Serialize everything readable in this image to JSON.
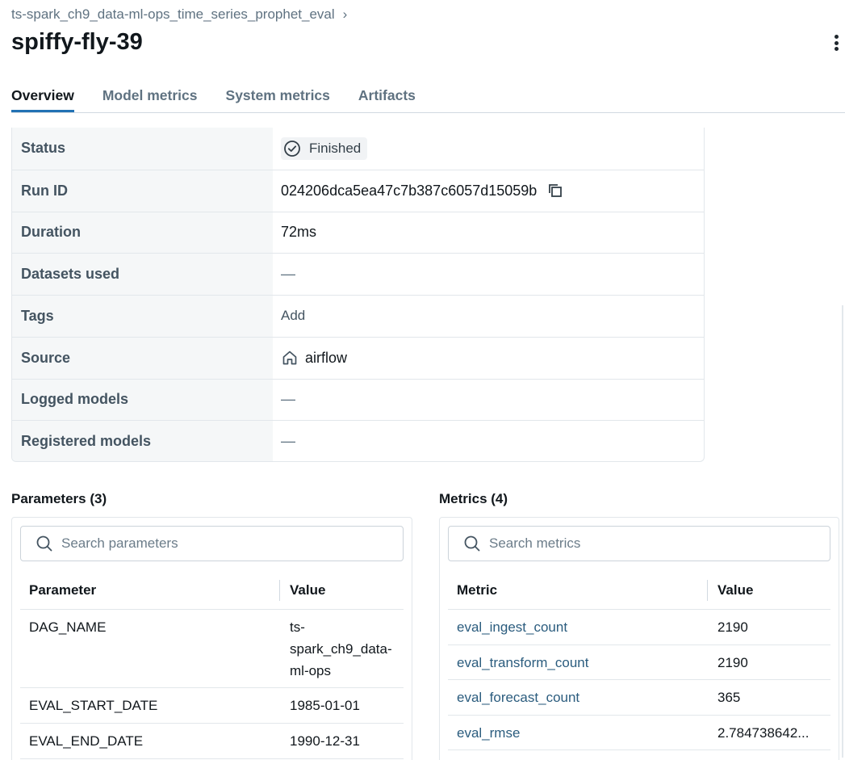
{
  "breadcrumb": {
    "experiment": "ts-spark_ch9_data-ml-ops_time_series_prophet_eval",
    "separator": "›"
  },
  "run": {
    "name": "spiffy-fly-39"
  },
  "tabs": [
    "Overview",
    "Model metrics",
    "System metrics",
    "Artifacts"
  ],
  "details": {
    "status": {
      "label": "Status",
      "value": "Finished",
      "icon": "check-circle-icon"
    },
    "run_id": {
      "label": "Run ID",
      "value": "024206dca5ea47c7b387c6057d15059b",
      "icon": "copy-icon"
    },
    "duration": {
      "label": "Duration",
      "value": "72ms"
    },
    "datasets": {
      "label": "Datasets used",
      "value": "—"
    },
    "tags": {
      "label": "Tags",
      "value": "Add"
    },
    "source": {
      "label": "Source",
      "value": "airflow",
      "icon": "home-icon"
    },
    "logged_models": {
      "label": "Logged models",
      "value": "—"
    },
    "registered_models": {
      "label": "Registered models",
      "value": "—"
    }
  },
  "parameters": {
    "title": "Parameters (3)",
    "search_placeholder": "Search parameters",
    "columns": [
      "Parameter",
      "Value"
    ],
    "rows": [
      {
        "name": "DAG_NAME",
        "value_lines": [
          "ts-",
          "spark_ch9_data-",
          "ml-ops"
        ]
      },
      {
        "name": "EVAL_START_DATE",
        "value_lines": [
          "1985-01-01"
        ]
      },
      {
        "name": "EVAL_END_DATE",
        "value_lines": [
          "1990-12-31"
        ]
      }
    ]
  },
  "metrics": {
    "title": "Metrics (4)",
    "search_placeholder": "Search metrics",
    "columns": [
      "Metric",
      "Value"
    ],
    "rows": [
      {
        "name": "eval_ingest_count",
        "value": "2190"
      },
      {
        "name": "eval_transform_count",
        "value": "2190"
      },
      {
        "name": "eval_forecast_count",
        "value": "365"
      },
      {
        "name": "eval_rmse",
        "value": "2.784738642..."
      }
    ]
  },
  "colors": {
    "accent": "#2272b4",
    "link": "#2b5c7e",
    "muted": "#5f7281"
  }
}
